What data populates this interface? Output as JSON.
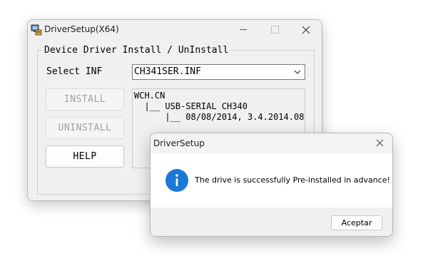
{
  "main_window": {
    "title": "DriverSetup(X64)",
    "icon": "computer-icon",
    "group_title": "Device Driver Install / UnInstall",
    "select_label": "Select INF",
    "inf_selected": "CH341SER.INF",
    "buttons": {
      "install": "INSTALL",
      "uninstall": "UNINSTALL",
      "help": "HELP"
    },
    "tree": [
      "WCH.CN",
      "  |__ USB-SERIAL CH340",
      "      |__ 08/08/2014, 3.4.2014.08"
    ]
  },
  "dialog": {
    "title": "DriverSetup",
    "icon": "info-icon",
    "message": "The drive is successfully Pre-installed in advance!",
    "accept_label": "Aceptar"
  },
  "colors": {
    "info_blue": "#1a78d6",
    "window_bg": "#f0f0f0"
  }
}
